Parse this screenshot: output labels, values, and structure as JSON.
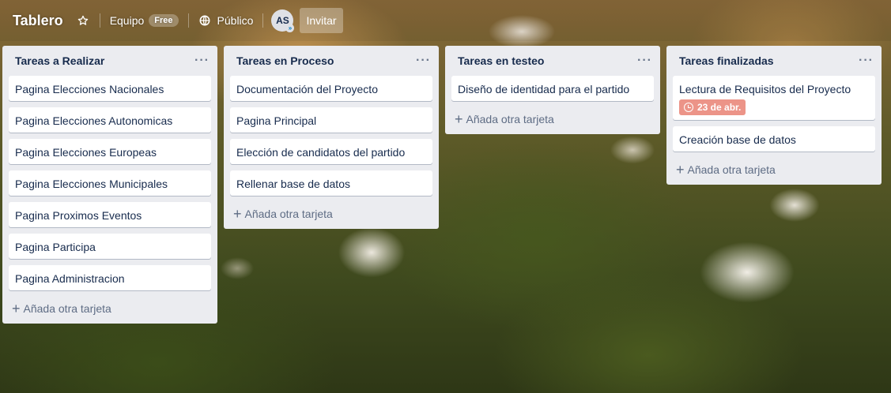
{
  "header": {
    "board_title": "Tablero",
    "star_icon": "star-icon",
    "team_label": "Equipo",
    "team_badge": "Free",
    "visibility_icon": "globe-icon",
    "visibility_label": "Público",
    "member_initials": "AS",
    "invite_label": "Invitar"
  },
  "lists": [
    {
      "title": "Tareas a Realizar",
      "menu": "···",
      "cards": [
        {
          "title": "Pagina Elecciones Nacionales"
        },
        {
          "title": "Pagina Elecciones Autonomicas"
        },
        {
          "title": "Pagina Elecciones Europeas"
        },
        {
          "title": "Pagina Elecciones Municipales"
        },
        {
          "title": "Pagina Proximos Eventos"
        },
        {
          "title": "Pagina Participa"
        },
        {
          "title": "Pagina Administracion"
        }
      ],
      "add_label": "Añada otra tarjeta"
    },
    {
      "title": "Tareas en Proceso",
      "menu": "···",
      "cards": [
        {
          "title": "Documentación del Proyecto"
        },
        {
          "title": "Pagina Principal"
        },
        {
          "title": "Elección de candidatos del partido"
        },
        {
          "title": "Rellenar base de datos"
        }
      ],
      "add_label": "Añada otra tarjeta"
    },
    {
      "title": "Tareas en testeo",
      "menu": "···",
      "cards": [
        {
          "title": "Diseño de identidad para el partido"
        }
      ],
      "add_label": "Añada otra tarjeta"
    },
    {
      "title": "Tareas finalizadas",
      "menu": "···",
      "cards": [
        {
          "title": "Lectura de Requisitos del Proyecto",
          "due": "23 de abr."
        },
        {
          "title": "Creación base de datos"
        }
      ],
      "add_label": "Añada otra tarjeta"
    }
  ],
  "colors": {
    "list_bg": "#ebecf0",
    "card_text": "#172b4d",
    "due_overdue": "#ec9488"
  }
}
